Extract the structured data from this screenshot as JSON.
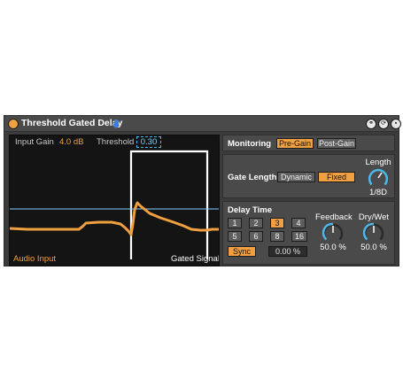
{
  "device": {
    "title": "Threshold Gated Delay",
    "colors": {
      "accent": "#f0a040",
      "threshold_line": "#7fd0ff",
      "panel": "#4a4a4a",
      "scope_bg": "#141414"
    }
  },
  "scope": {
    "input_gain_label": "Input Gain",
    "input_gain_value": "4.0 dB",
    "threshold_label": "Threshold",
    "threshold_value": "0.30",
    "audio_input_label": "Audio Input",
    "gated_signal_label": "Gated Signal"
  },
  "monitoring": {
    "label": "Monitoring",
    "options": [
      "Pre-Gain",
      "Post-Gain"
    ],
    "selected": "Pre-Gain"
  },
  "gate_length": {
    "label": "Gate Length",
    "options": [
      "Dynamic",
      "Fixed"
    ],
    "selected": "Fixed",
    "knob_label": "Length",
    "knob_value": "1/8D"
  },
  "delay_time": {
    "label": "Delay Time",
    "grid": [
      "1",
      "2",
      "3",
      "4",
      "5",
      "6",
      "8",
      "16"
    ],
    "selected": "3",
    "sync_label": "Sync",
    "offset_value": "0.00 %"
  },
  "feedback": {
    "label": "Feedback",
    "value": "50.0 %"
  },
  "dry_wet": {
    "label": "Dry/Wet",
    "value": "50.0 %"
  }
}
